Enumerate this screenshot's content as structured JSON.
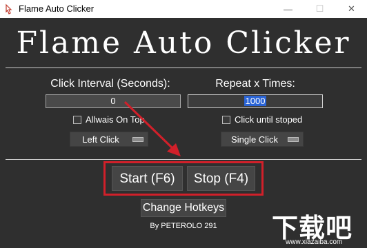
{
  "window": {
    "title": "Flame Auto Clicker",
    "minimize_glyph": "—",
    "maximize_glyph": "☐",
    "close_glyph": "✕",
    "accent_color": "#d1202a"
  },
  "header": {
    "title": "Flame Auto Clicker"
  },
  "settings": {
    "interval_label": "Click Interval (Seconds):",
    "interval_value": "0",
    "repeat_label": "Repeat x Times:",
    "repeat_value": "1000",
    "always_on_top_label": "Allwais On Top",
    "always_on_top_checked": false,
    "click_until_stopped_label": "Click until stoped",
    "click_until_stopped_checked": false,
    "mouse_button_value": "Left Click",
    "click_type_value": "Single Click"
  },
  "actions": {
    "start_label": "Start (F6)",
    "stop_label": "Stop (F4)",
    "hotkeys_label": "Change Hotkeys"
  },
  "footer": {
    "credit": "By PETEROLO 291"
  },
  "watermark": {
    "text": "下载吧",
    "url": "www.xiazaiba.com"
  },
  "icons": {
    "app": "flame-icon",
    "annotation": "red-arrow-icon"
  }
}
